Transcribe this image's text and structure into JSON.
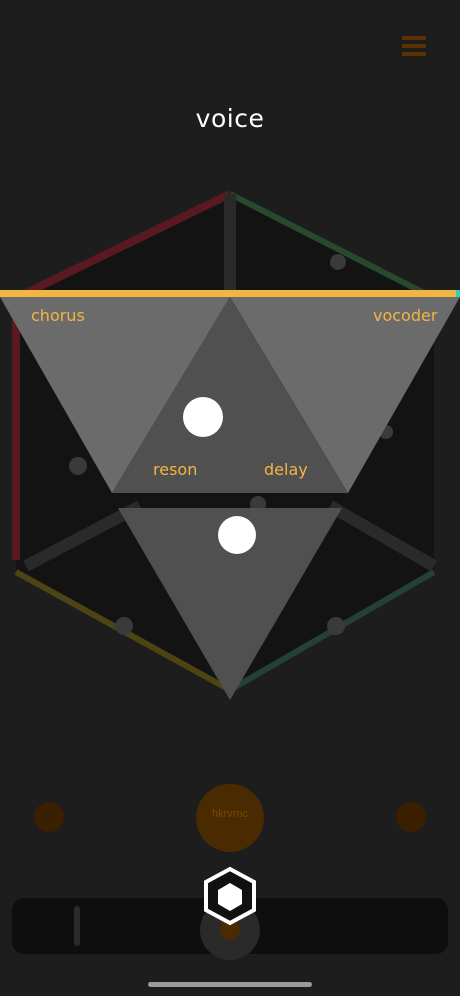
{
  "screen": {
    "title": "voice",
    "menu_icon": "hamburger-menu-icon"
  },
  "effects": {
    "chorus": "chorus",
    "vocoder": "vocoder",
    "reson": "reson",
    "delay": "delay"
  },
  "controls": {
    "record_button_label": "hkrvrnc",
    "left_icon": "dial-icon",
    "right_icon": "toggle-icon",
    "hexagon_button_icon": "hexagon-icon"
  },
  "colors": {
    "accent": "#f2b640",
    "panel": "#6a6a6a",
    "hex_red": "#7a1f2a",
    "hex_green": "#2e5e3a",
    "hex_yellow": "#6a5d1a",
    "dim_orange": "#5a3200",
    "teal": "#2bd1c1"
  }
}
